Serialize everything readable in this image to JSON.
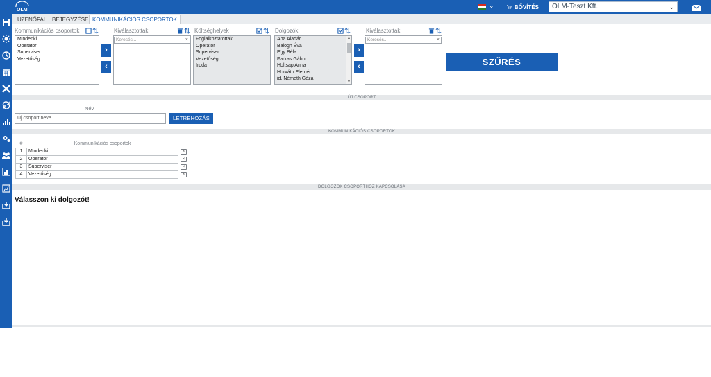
{
  "header": {
    "logo_text": "OLM",
    "cart_label": "BŐVÍTÉS",
    "company_select": "OLM-Teszt Kft.",
    "flag_colors": [
      "#d52b1e",
      "#ffffff",
      "#2a7d2a"
    ]
  },
  "sidebar": {
    "icons": [
      "save-icon",
      "sun-icon",
      "clock-icon",
      "calendar-icon",
      "tools-icon",
      "sync-icon",
      "chart-icon",
      "settings-icon",
      "users-icon",
      "stats-icon",
      "report-icon",
      "download-icon",
      "download2-icon"
    ]
  },
  "tabs": [
    {
      "label": "ÜZENŐFAL"
    },
    {
      "label": "BEJEGYZÉSEK"
    },
    {
      "label": "KOMMUNIKÁCIÓS CSOPORTOK"
    }
  ],
  "filters": {
    "comm_groups": {
      "label": "Kommunikációs csoportok",
      "items": [
        "Mindenki",
        "Operator",
        "Superviser",
        "Vezetőség"
      ]
    },
    "selected1": {
      "label": "Kiválasztottak",
      "search_placeholder": "Keresés..."
    },
    "cost_centers": {
      "label": "Költséghelyek",
      "items": [
        "Foglalkoztatottak",
        "Operator",
        "Superviser",
        "Vezetőség",
        "Iroda"
      ]
    },
    "employees": {
      "label": "Dolgozók",
      "items": [
        "Aba Aladár",
        "Balogh Éva",
        "Egy Béla",
        "Farkas Gábor",
        "Holtsap Anna",
        "Horváth Elemér",
        "id. Németh Géza"
      ]
    },
    "selected2": {
      "label": "Kiválasztottak",
      "search_placeholder": "Keresés..."
    },
    "filter_button": "SZŰRÉS",
    "arrow_right": "›",
    "arrow_left": "‹"
  },
  "new_group": {
    "section_title": "ÚJ CSOPORT",
    "name_label": "Név",
    "input_value": "Új csoport neve",
    "create_button": "LÉTREHOZÁS"
  },
  "groups_table": {
    "section_title": "KOMMUNIKÁCIÓS CSOPORTOK",
    "col_num": "#",
    "col_name": "Kommunikációs csoportok",
    "rows": [
      {
        "num": "1",
        "name": "Mindenki"
      },
      {
        "num": "2",
        "name": "Operator"
      },
      {
        "num": "3",
        "name": "Superviser"
      },
      {
        "num": "4",
        "name": "Vezetőség"
      }
    ],
    "delete_glyph": "×"
  },
  "assign": {
    "section_title": "DOLGOZÓK CSOPORTHOZ KAPCSOLÁSA",
    "message": "Válasszon ki dolgozót!"
  }
}
